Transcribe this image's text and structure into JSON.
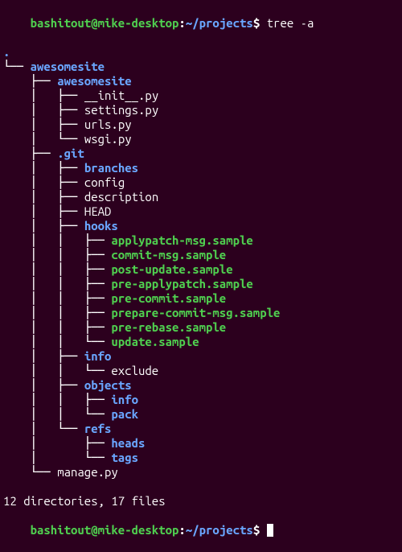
{
  "prompt": {
    "user_host": "bashitout@mike-desktop",
    "sep1": ":",
    "path": "~/projects",
    "sep2": "$ "
  },
  "command": "tree -a",
  "tree_root_dot": ".",
  "summary": "12 directories, 17 files",
  "lines": [
    {
      "struct": "└── ",
      "cls": "dir",
      "text": "awesomesite"
    },
    {
      "struct": "    ├── ",
      "cls": "dir",
      "text": "awesomesite"
    },
    {
      "struct": "    │   ├── ",
      "cls": "file",
      "text": "__init__.py"
    },
    {
      "struct": "    │   ├── ",
      "cls": "file",
      "text": "settings.py"
    },
    {
      "struct": "    │   ├── ",
      "cls": "file",
      "text": "urls.py"
    },
    {
      "struct": "    │   └── ",
      "cls": "file",
      "text": "wsgi.py"
    },
    {
      "struct": "    ├── ",
      "cls": "dir",
      "text": ".git"
    },
    {
      "struct": "    │   ├── ",
      "cls": "dir",
      "text": "branches"
    },
    {
      "struct": "    │   ├── ",
      "cls": "file",
      "text": "config"
    },
    {
      "struct": "    │   ├── ",
      "cls": "file",
      "text": "description"
    },
    {
      "struct": "    │   ├── ",
      "cls": "file",
      "text": "HEAD"
    },
    {
      "struct": "    │   ├── ",
      "cls": "dir",
      "text": "hooks"
    },
    {
      "struct": "    │   │   ├── ",
      "cls": "exec",
      "text": "applypatch-msg.sample"
    },
    {
      "struct": "    │   │   ├── ",
      "cls": "exec",
      "text": "commit-msg.sample"
    },
    {
      "struct": "    │   │   ├── ",
      "cls": "exec",
      "text": "post-update.sample"
    },
    {
      "struct": "    │   │   ├── ",
      "cls": "exec",
      "text": "pre-applypatch.sample"
    },
    {
      "struct": "    │   │   ├── ",
      "cls": "exec",
      "text": "pre-commit.sample"
    },
    {
      "struct": "    │   │   ├── ",
      "cls": "exec",
      "text": "prepare-commit-msg.sample"
    },
    {
      "struct": "    │   │   ├── ",
      "cls": "exec",
      "text": "pre-rebase.sample"
    },
    {
      "struct": "    │   │   └── ",
      "cls": "exec",
      "text": "update.sample"
    },
    {
      "struct": "    │   ├── ",
      "cls": "dir",
      "text": "info"
    },
    {
      "struct": "    │   │   └── ",
      "cls": "file",
      "text": "exclude"
    },
    {
      "struct": "    │   ├── ",
      "cls": "dir",
      "text": "objects"
    },
    {
      "struct": "    │   │   ├── ",
      "cls": "dir",
      "text": "info"
    },
    {
      "struct": "    │   │   └── ",
      "cls": "dir",
      "text": "pack"
    },
    {
      "struct": "    │   └── ",
      "cls": "dir",
      "text": "refs"
    },
    {
      "struct": "    │       ├── ",
      "cls": "dir",
      "text": "heads"
    },
    {
      "struct": "    │       └── ",
      "cls": "dir",
      "text": "tags"
    },
    {
      "struct": "    └── ",
      "cls": "file",
      "text": "manage.py"
    }
  ]
}
